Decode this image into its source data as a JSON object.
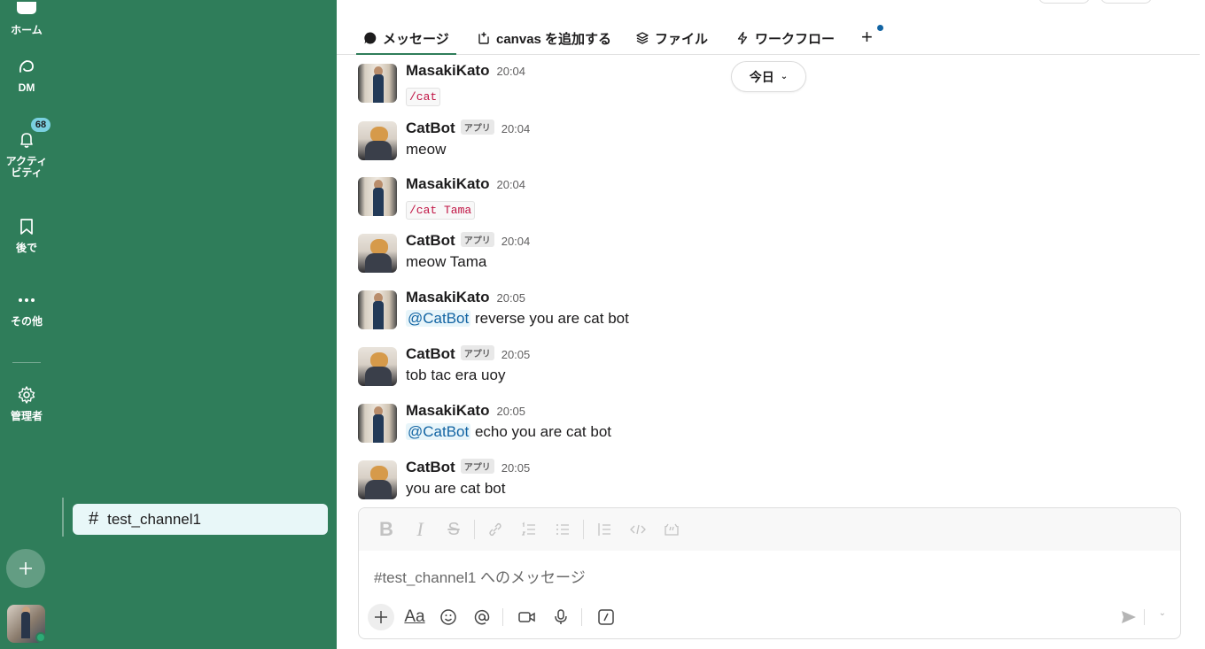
{
  "rail": {
    "home_label": "ホーム",
    "dm_label": "DM",
    "activity_label": "アクティ\nビティ",
    "activity_badge": "68",
    "later_label": "後で",
    "more_label": "その他",
    "admin_label": "管理者"
  },
  "sidebar": {
    "channel_hash": "#",
    "active_channel": "test_channel1"
  },
  "tabs": {
    "messages": "メッセージ",
    "canvas": "canvas を追加する",
    "files": "ファイル",
    "workflow": "ワークフロー",
    "add": "+"
  },
  "date_pill": {
    "label": "今日",
    "chevron": "⌄"
  },
  "messages": [
    {
      "sender": "MasakiKato",
      "avatar": "masaki",
      "time": "20:04",
      "app": "",
      "type": "code",
      "text": "/cat"
    },
    {
      "sender": "CatBot",
      "avatar": "cat",
      "time": "20:04",
      "app": "アプリ",
      "type": "text",
      "text": "meow"
    },
    {
      "sender": "MasakiKato",
      "avatar": "masaki",
      "time": "20:04",
      "app": "",
      "type": "code",
      "text": "/cat Tama"
    },
    {
      "sender": "CatBot",
      "avatar": "cat",
      "time": "20:04",
      "app": "アプリ",
      "type": "text",
      "text": "meow Tama"
    },
    {
      "sender": "MasakiKato",
      "avatar": "masaki",
      "time": "20:05",
      "app": "",
      "type": "mention",
      "mention": "@CatBot",
      "text": " reverse you are cat bot"
    },
    {
      "sender": "CatBot",
      "avatar": "cat",
      "time": "20:05",
      "app": "アプリ",
      "type": "text",
      "text": "tob tac era uoy"
    },
    {
      "sender": "MasakiKato",
      "avatar": "masaki",
      "time": "20:05",
      "app": "",
      "type": "mention",
      "mention": "@CatBot",
      "text": " echo you are cat bot"
    },
    {
      "sender": "CatBot",
      "avatar": "cat",
      "time": "20:05",
      "app": "アプリ",
      "type": "text",
      "text": "you are cat bot"
    }
  ],
  "composer": {
    "placeholder": "#test_channel1 へのメッセージ",
    "format_buttons": [
      "bold-icon",
      "italic-icon",
      "strikethrough-icon",
      "link-icon",
      "ordered-list-icon",
      "bullet-list-icon",
      "blockquote-icon",
      "code-icon",
      "code-block-icon"
    ],
    "action_buttons": [
      "plus-icon",
      "text-format-icon",
      "emoji-icon",
      "mention-icon",
      "video-icon",
      "microphone-icon",
      "slash-command-icon"
    ],
    "text_format_label": "Aa"
  },
  "colors": {
    "sidebar_bg": "#2f7d5a",
    "active_channel_bg": "#e8f7f8",
    "mention": "#1264a3",
    "code": "#c01343",
    "badge": "#7ad0e0"
  }
}
